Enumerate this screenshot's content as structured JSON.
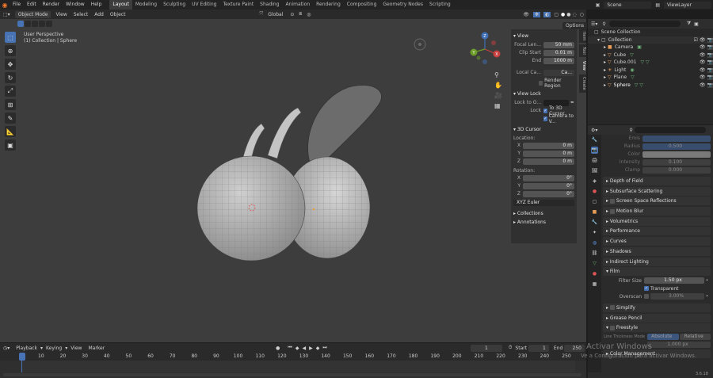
{
  "menu": [
    "File",
    "Edit",
    "Render",
    "Window",
    "Help"
  ],
  "workspaces": [
    "Layout",
    "Modeling",
    "Sculpting",
    "UV Editing",
    "Texture Paint",
    "Shading",
    "Animation",
    "Rendering",
    "Compositing",
    "Geometry Nodes",
    "Scripting"
  ],
  "active_workspace": "Layout",
  "scene": {
    "label": "Scene",
    "viewlayer": "ViewLayer"
  },
  "header": {
    "mode": "Object Mode",
    "view": "View",
    "select": "Select",
    "add": "Add",
    "object": "Object",
    "orientation": "Global",
    "options": "Options"
  },
  "viewport": {
    "perspective": "User Perspective",
    "collection": "(1) Collection | Sphere"
  },
  "gizmo": {
    "x": "X",
    "y": "Y",
    "z": "Z"
  },
  "npanel": {
    "view_title": "View",
    "focal_label": "Focal Len...",
    "focal_value": "50 mm",
    "clip_start_label": "Clip Start",
    "clip_start_value": "0.01 m",
    "end_label": "End",
    "end_value": "1000 m",
    "local_camera_label": "Local Ca...",
    "local_camera_value": "Ca...",
    "render_region": "Render Region",
    "view_lock_title": "View Lock",
    "lock_to_label": "Lock to O...",
    "lock_label": "Lock",
    "lock_3d_cursor": "To 3D Cursor",
    "camera_to_view": "Camera to V...",
    "cursor_title": "3D Cursor",
    "location_label": "Location:",
    "loc_x": "0 m",
    "loc_y": "0 m",
    "loc_z": "0 m",
    "rotation_label": "Rotation:",
    "rot_x": "0°",
    "rot_y": "0°",
    "rot_z": "0°",
    "rotation_mode": "XYZ Euler",
    "collections": "Collections",
    "annotations": "Annotations",
    "axis_x": "X",
    "axis_y": "Y",
    "axis_z": "Z"
  },
  "vtabs": [
    "Item",
    "Tool",
    "View",
    "Create"
  ],
  "outliner": {
    "scene_collection": "Scene Collection",
    "collection": "Collection",
    "items": [
      "Camera",
      "Cube",
      "Cube.001",
      "Light",
      "Plane",
      "Sphere"
    ]
  },
  "props": {
    "emis_label": "Emis",
    "radius_label": "Radius",
    "radius_value": "0.500",
    "color_label": "Color",
    "intensity_label": "Intensity",
    "intensity_value": "0.100",
    "clamp_label": "Clamp",
    "clamp_value": "0.000",
    "panels": [
      "Depth of Field",
      "Subsurface Scattering",
      "Screen Space Reflections",
      "Motion Blur",
      "Volumetrics",
      "Performance",
      "Curves",
      "Shadows",
      "Indirect Lighting",
      "Film"
    ],
    "film_filter_label": "Filter Size",
    "film_filter_value": "1.50 px",
    "transparent": "Transparent",
    "overscan_label": "Overscan",
    "overscan_value": "3.00%",
    "after_panels": [
      "Simplify",
      "Grease Pencil",
      "Freestyle"
    ],
    "line_thickness_label": "Line Thickness Mode",
    "absolute": "Absolute",
    "relative": "Relative",
    "line_thickness_value": "1.000 px",
    "color_management": "Color Management",
    "version": "3.6.18"
  },
  "timeline": {
    "playback": "Playback",
    "keying": "Keying",
    "view": "View",
    "marker": "Marker",
    "current_frame": "1",
    "start_label": "Start",
    "start_value": "1",
    "end_label": "End",
    "end_value": "250",
    "ticks": [
      "1",
      "10",
      "20",
      "30",
      "40",
      "50",
      "60",
      "70",
      "80",
      "90",
      "100",
      "110",
      "120",
      "130",
      "140",
      "150",
      "160",
      "170",
      "180",
      "190",
      "200",
      "210",
      "220",
      "230",
      "240",
      "250"
    ]
  },
  "watermark": {
    "line1": "Activar Windows",
    "line2": "Ve a Configuración para activar Windows."
  }
}
